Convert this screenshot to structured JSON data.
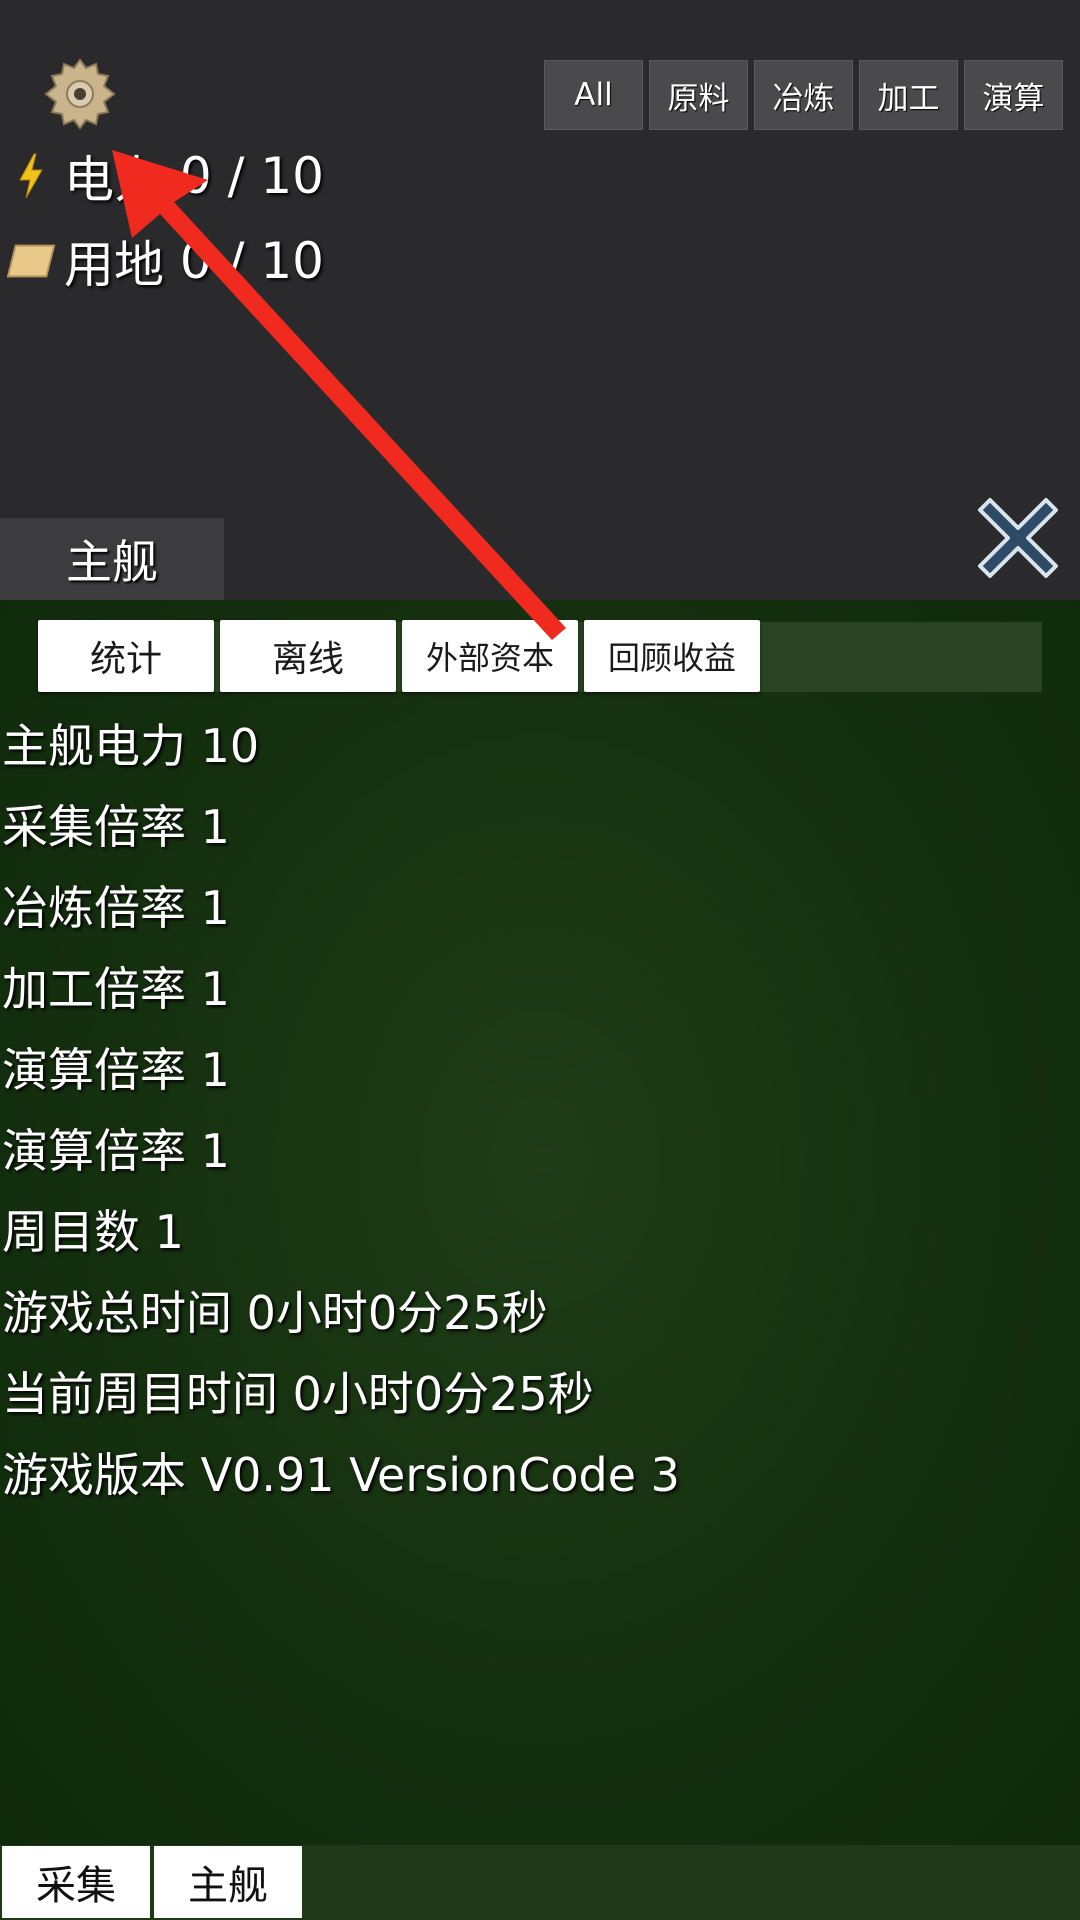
{
  "filters": [
    "All",
    "原料",
    "冶炼",
    "加工",
    "演算"
  ],
  "resources": {
    "power": {
      "label": "电力",
      "value": "0 / 10"
    },
    "land": {
      "label": "用地",
      "value": "0 / 10"
    }
  },
  "section_tab": "主舰",
  "subtabs": [
    "统计",
    "离线",
    "外部资本",
    "回顾收益"
  ],
  "stats": [
    "主舰电力 10",
    "采集倍率 1",
    "冶炼倍率 1",
    "加工倍率 1",
    "演算倍率 1",
    "演算倍率 1",
    "周目数 1",
    "游戏总时间 0小时0分25秒",
    "当前周目时间 0小时0分25秒",
    "游戏版本 V0.91 VersionCode 3"
  ],
  "bottom_nav": [
    "采集",
    "主舰"
  ],
  "colors": {
    "panel": "#15300f",
    "top": "#2a2a2c",
    "arrow": "#f02a1e",
    "close": "#2e4a66"
  },
  "icons": [
    "gear-icon",
    "lightning-icon",
    "land-icon",
    "close-icon"
  ]
}
